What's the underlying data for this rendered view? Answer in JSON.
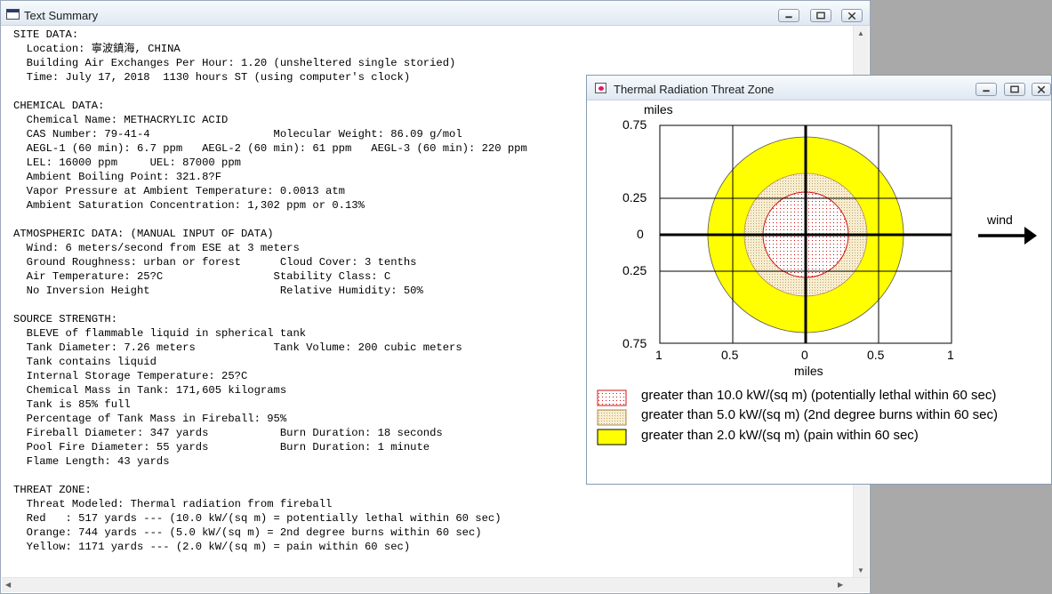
{
  "text_window": {
    "title": "Text Summary",
    "lines": [
      "SITE DATA:",
      "  Location: 寧波鎮海, CHINA",
      "  Building Air Exchanges Per Hour: 1.20 (unsheltered single storied)",
      "  Time: July 17, 2018  1130 hours ST (using computer's clock)",
      "",
      "CHEMICAL DATA:",
      "  Chemical Name: METHACRYLIC ACID",
      "  CAS Number: 79-41-4                   Molecular Weight: 86.09 g/mol",
      "  AEGL-1 (60 min): 6.7 ppm   AEGL-2 (60 min): 61 ppm   AEGL-3 (60 min): 220 ppm",
      "  LEL: 16000 ppm     UEL: 87000 ppm",
      "  Ambient Boiling Point: 321.8?F",
      "  Vapor Pressure at Ambient Temperature: 0.0013 atm",
      "  Ambient Saturation Concentration: 1,302 ppm or 0.13%",
      "",
      "ATMOSPHERIC DATA: (MANUAL INPUT OF DATA)",
      "  Wind: 6 meters/second from ESE at 3 meters",
      "  Ground Roughness: urban or forest      Cloud Cover: 3 tenths",
      "  Air Temperature: 25?C                 Stability Class: C",
      "  No Inversion Height                    Relative Humidity: 50%",
      "",
      "SOURCE STRENGTH:",
      "  BLEVE of flammable liquid in spherical tank",
      "  Tank Diameter: 7.26 meters            Tank Volume: 200 cubic meters",
      "  Tank contains liquid",
      "  Internal Storage Temperature: 25?C",
      "  Chemical Mass in Tank: 171,605 kilograms",
      "  Tank is 85% full",
      "  Percentage of Tank Mass in Fireball: 95%",
      "  Fireball Diameter: 347 yards           Burn Duration: 18 seconds",
      "  Pool Fire Diameter: 55 yards           Burn Duration: 1 minute",
      "  Flame Length: 43 yards",
      "",
      "THREAT ZONE:",
      "  Threat Modeled: Thermal radiation from fireball",
      "  Red   : 517 yards --- (10.0 kW/(sq m) = potentially lethal within 60 sec)",
      "  Orange: 744 yards --- (5.0 kW/(sq m) = 2nd degree burns within 60 sec)",
      "  Yellow: 1171 yards --- (2.0 kW/(sq m) = pain within 60 sec)"
    ]
  },
  "threat_window": {
    "title": "Thermal Radiation Threat Zone",
    "y_unit": "miles",
    "x_unit": "miles",
    "y_ticks": [
      "0.75",
      "0.25",
      "0",
      "0.25",
      "0.75"
    ],
    "x_ticks": [
      "1",
      "0.5",
      "0",
      "0.5",
      "1"
    ],
    "wind_label": "wind",
    "legend": [
      {
        "label": "greater than 10.0 kW/(sq m) (potentially lethal within 60 sec)"
      },
      {
        "label": "greater than 5.0 kW/(sq m) (2nd degree burns within 60 sec)"
      },
      {
        "label": "greater than 2.0 kW/(sq m) (pain within 60 sec)"
      }
    ],
    "colors": {
      "red_zone_outline": "#d01010",
      "orange_zone_fill": "#f3e5b6",
      "yellow_zone_fill": "#ffff00"
    }
  },
  "window_controls": [
    "minimize",
    "maximize",
    "close"
  ]
}
